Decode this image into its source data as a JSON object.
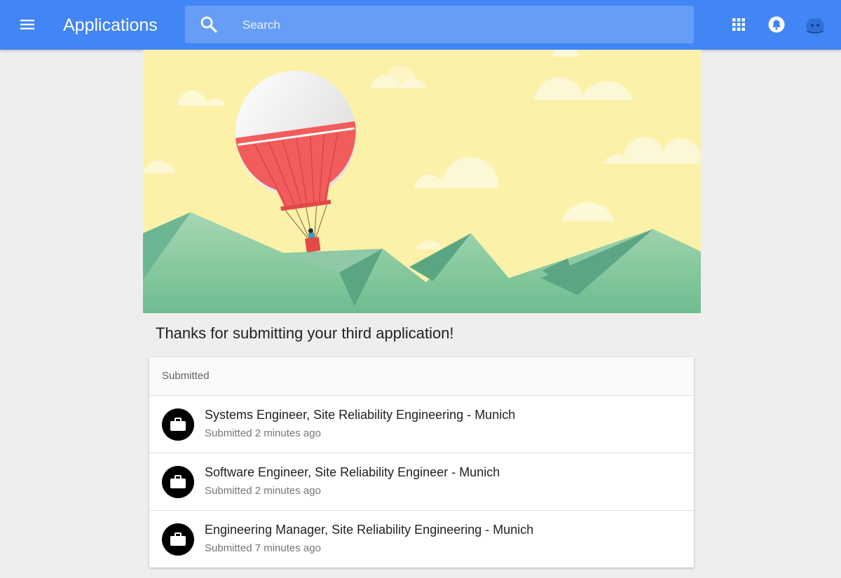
{
  "header": {
    "menu_icon": "menu-icon",
    "title": "Applications",
    "search": {
      "placeholder": "Search",
      "icon": "search-icon"
    },
    "apps_icon": "apps-grid-icon",
    "notifications_icon": "bell-icon",
    "avatar_icon": "avatar-icon",
    "color": "#4285f4"
  },
  "hero": {
    "image": "hot-air-balloon-illustration"
  },
  "main": {
    "thanks_message": "Thanks for submitting your third application!",
    "card": {
      "header": "Submitted",
      "items": [
        {
          "icon": "briefcase-icon",
          "title": "Systems Engineer, Site Reliability Engineering - Munich",
          "subtitle": "Submitted 2 minutes ago"
        },
        {
          "icon": "briefcase-icon",
          "title": "Software Engineer, Site Reliability Engineer - Munich",
          "subtitle": "Submitted 2 minutes ago"
        },
        {
          "icon": "briefcase-icon",
          "title": "Engineering Manager, Site Reliability Engineering - Munich",
          "subtitle": "Submitted 7 minutes ago"
        }
      ]
    }
  }
}
